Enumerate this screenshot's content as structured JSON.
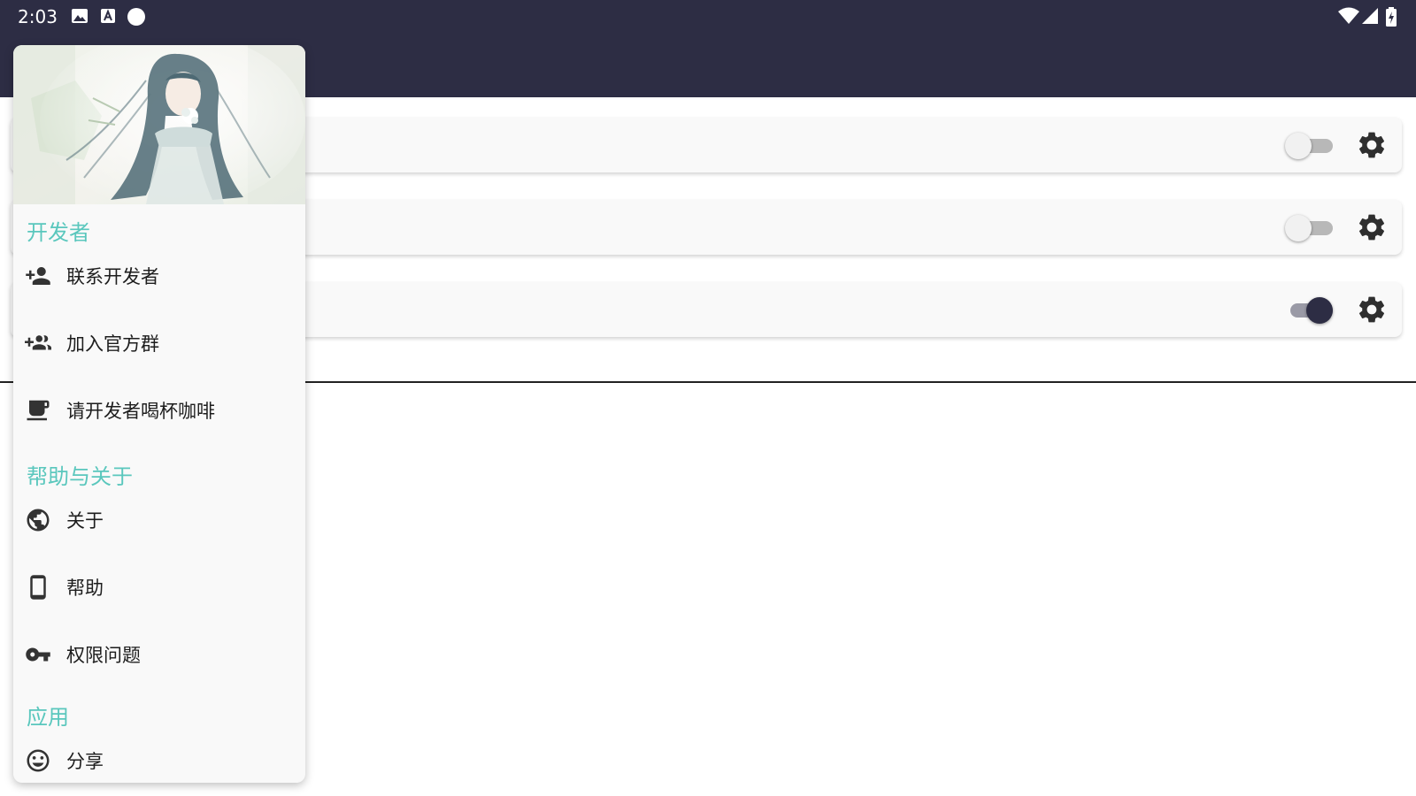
{
  "status_bar": {
    "time": "2:03",
    "left_icons": [
      "image-icon",
      "font-a-icon",
      "circle-icon"
    ],
    "right_icons": [
      "wifi-icon",
      "signal-icon",
      "battery-charging-icon"
    ]
  },
  "colors": {
    "primary_dark": "#2d2d44",
    "section_accent": "#5ac7bd",
    "card_background": "#f9f9f9"
  },
  "cards": [
    {
      "toggle_on": false,
      "toggle_icon": "switch-icon",
      "settings_icon": "gear-icon"
    },
    {
      "toggle_on": false,
      "toggle_icon": "switch-icon",
      "settings_icon": "gear-icon"
    },
    {
      "toggle_on": true,
      "toggle_icon": "switch-icon",
      "settings_icon": "gear-icon"
    }
  ],
  "drawer": {
    "header_image": "anime-girl-header-image",
    "sections": [
      {
        "title": "开发者",
        "items": [
          {
            "label": "联系开发者",
            "icon": "person-add-icon"
          },
          {
            "label": "加入官方群",
            "icon": "group-add-icon"
          },
          {
            "label": "请开发者喝杯咖啡",
            "icon": "coffee-icon"
          }
        ]
      },
      {
        "title": "帮助与关于",
        "items": [
          {
            "label": "关于",
            "icon": "globe-icon"
          },
          {
            "label": "帮助",
            "icon": "phone-icon"
          },
          {
            "label": "权限问题",
            "icon": "key-icon"
          }
        ]
      },
      {
        "title": "应用",
        "items": [
          {
            "label": "分享",
            "icon": "smiley-icon"
          }
        ]
      }
    ]
  }
}
